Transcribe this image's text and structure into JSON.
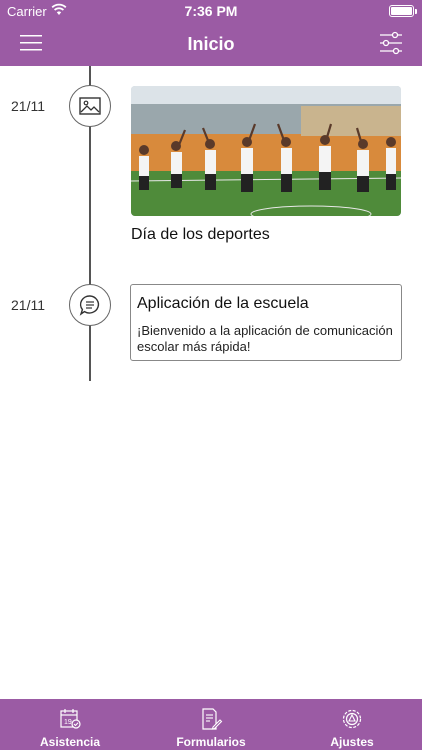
{
  "status_bar": {
    "carrier": "Carrier",
    "time": "7:36 PM",
    "wifi_icon": "wifi-icon",
    "battery_level": 1.0
  },
  "header": {
    "title": "Inicio",
    "menu_icon": "hamburger-menu-icon",
    "filter_icon": "filter-sliders-icon"
  },
  "timeline": [
    {
      "date": "21/11",
      "icon": "image-icon",
      "type": "photo",
      "caption": "Día de los deportes"
    },
    {
      "date": "21/11",
      "icon": "chat-bubble-icon",
      "type": "message",
      "title": "Aplicación de la escuela",
      "body": "¡Bienvenido a la aplicación de comunicación escolar más rápida!"
    }
  ],
  "tabs": [
    {
      "label": "Asistencia",
      "icon": "calendar-check-icon"
    },
    {
      "label": "Formularios",
      "icon": "form-edit-icon"
    },
    {
      "label": "Ajustes",
      "icon": "settings-gear-icon"
    }
  ],
  "colors": {
    "brand": "#9b5ba4",
    "text": "#111111",
    "line": "#555555"
  }
}
